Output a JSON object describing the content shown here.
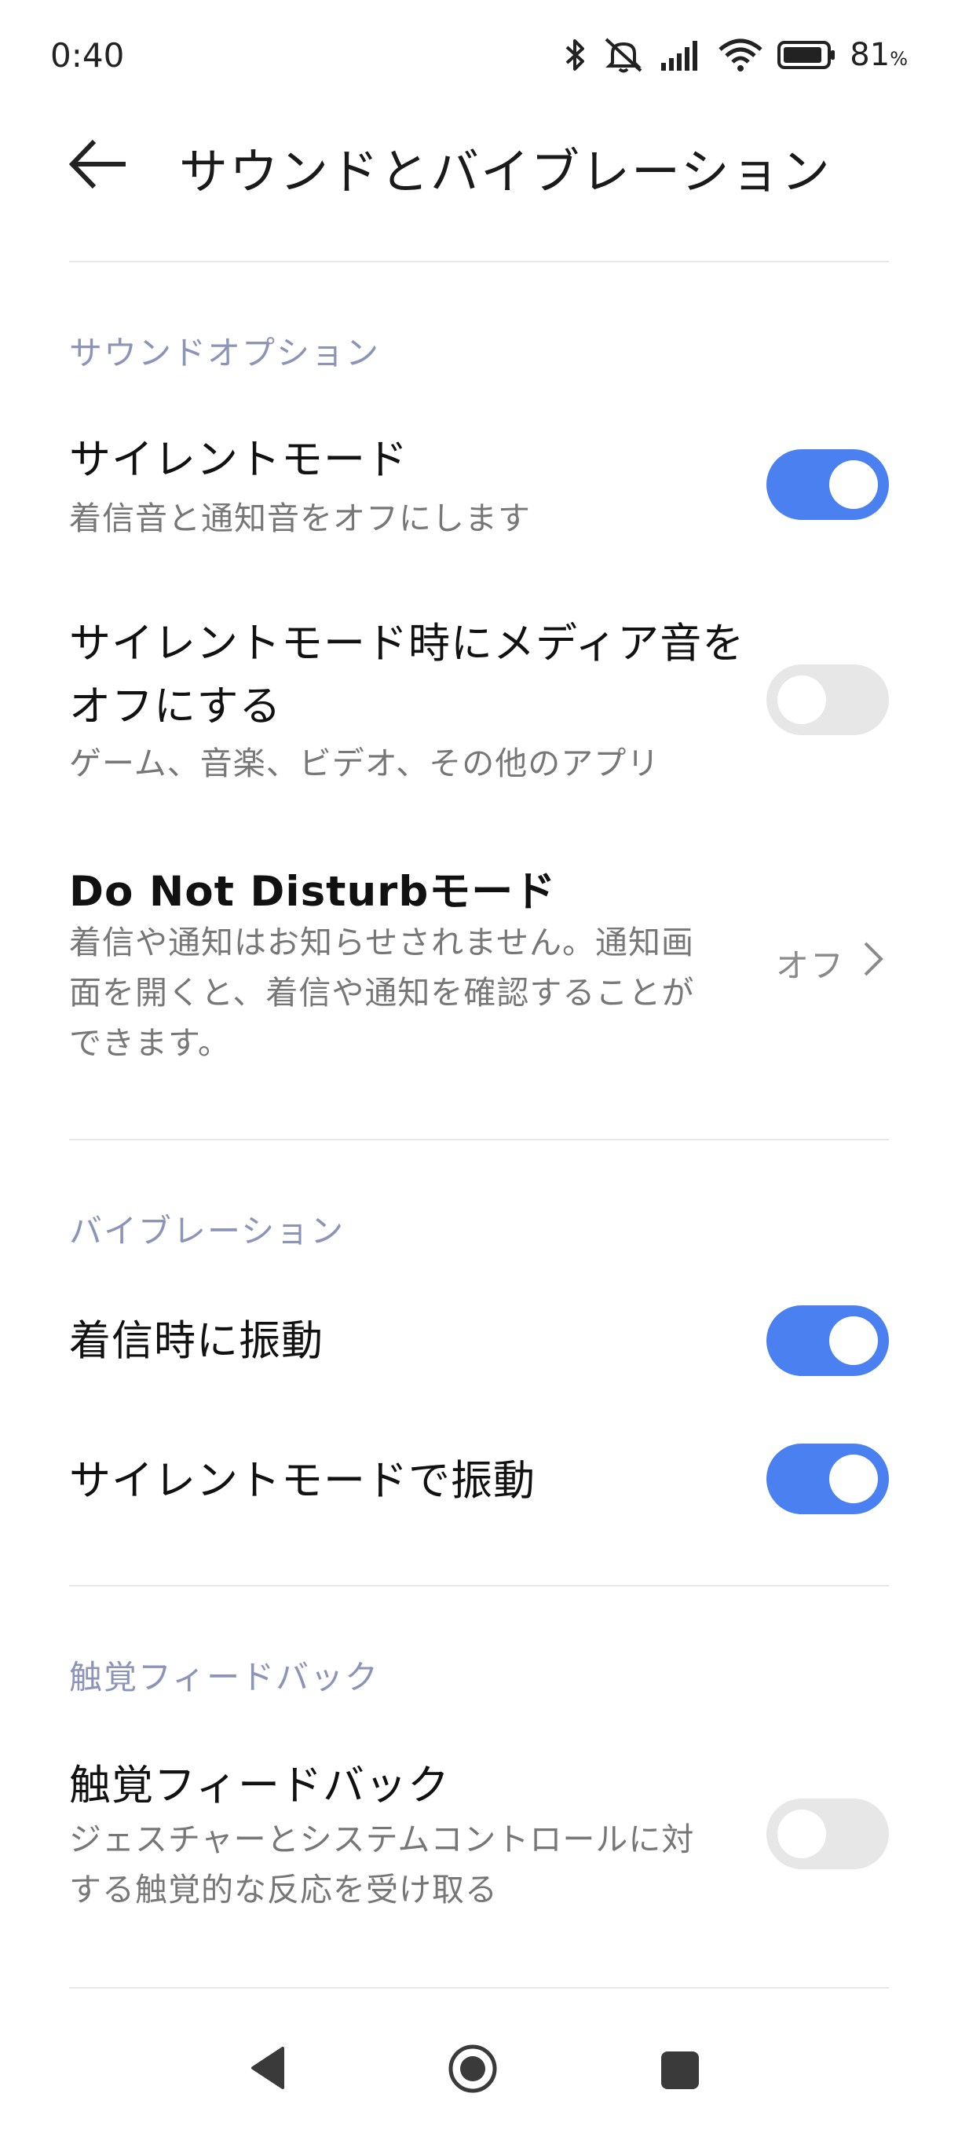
{
  "status_bar": {
    "time": "0:40",
    "battery_percent": "81",
    "battery_unit": "%"
  },
  "header": {
    "title": "サウンドとバイブレーション"
  },
  "sections": {
    "sound_options": {
      "label": "サウンドオプション",
      "silent_mode": {
        "title": "サイレントモード",
        "subtitle": "着信音と通知音をオフにします",
        "enabled": true
      },
      "mute_media": {
        "title_line1": "サイレントモード時にメディア音を",
        "title_line2": "オフにする",
        "subtitle": "ゲーム、音楽、ビデオ、その他のアプリ",
        "enabled": false
      },
      "dnd": {
        "title": "Do Not Disturbモード",
        "subtitle_line1": "着信や通知はお知らせされません。通知画",
        "subtitle_line2": "面を開くと、着信や通知を確認することが",
        "subtitle_line3": "できます。",
        "value": "オフ"
      }
    },
    "vibration": {
      "label": "バイブレーション",
      "vibrate_on_ring": {
        "title": "着信時に振動",
        "enabled": true
      },
      "vibrate_silent": {
        "title": "サイレントモードで振動",
        "enabled": true
      }
    },
    "haptics": {
      "label": "触覚フィードバック",
      "haptic_feedback": {
        "title": "触覚フィードバック",
        "subtitle_line1": "ジェスチャーとシステムコントロールに対",
        "subtitle_line2": "する触覚的な反応を受け取る",
        "enabled": false
      }
    }
  },
  "icons": [
    "bluetooth-icon",
    "mute-bell-icon",
    "signal-icon",
    "wifi-icon",
    "battery-icon",
    "back-arrow-icon",
    "chevron-right-icon",
    "nav-back-icon",
    "nav-home-icon",
    "nav-recents-icon"
  ],
  "colors": {
    "accent": "#4a80f0",
    "section_label": "#8c95b8"
  }
}
